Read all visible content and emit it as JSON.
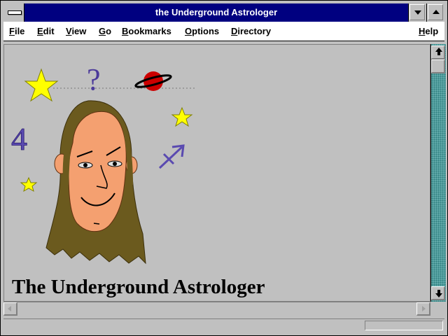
{
  "window": {
    "title": "the Underground Astrologer"
  },
  "menubar": {
    "items": [
      {
        "underline": "F",
        "rest": "ile"
      },
      {
        "underline": "E",
        "rest": "dit"
      },
      {
        "underline": "V",
        "rest": "iew"
      },
      {
        "underline": "G",
        "rest": "o"
      },
      {
        "underline": "B",
        "rest": "ookmarks"
      },
      {
        "underline": "O",
        "rest": "ptions"
      },
      {
        "underline": "D",
        "rest": "irectory"
      },
      {
        "underline": "H",
        "rest": "elp"
      }
    ]
  },
  "page": {
    "heading": "The Underground Astrologer",
    "art": {
      "question_mark": "?",
      "jupiter_glyph": "4"
    }
  },
  "statusbar": {
    "text": ""
  },
  "colors": {
    "titlebar": "#000080",
    "star": "#ffff00",
    "planet": "#cc0000",
    "hair": "#6b5a1e",
    "face": "#f4a070",
    "glyph": "#4b3a9a"
  },
  "icons": [
    "system-menu-icon",
    "minimize-icon",
    "maximize-icon",
    "scroll-up-icon",
    "scroll-down-icon",
    "scroll-left-icon",
    "scroll-right-icon"
  ]
}
